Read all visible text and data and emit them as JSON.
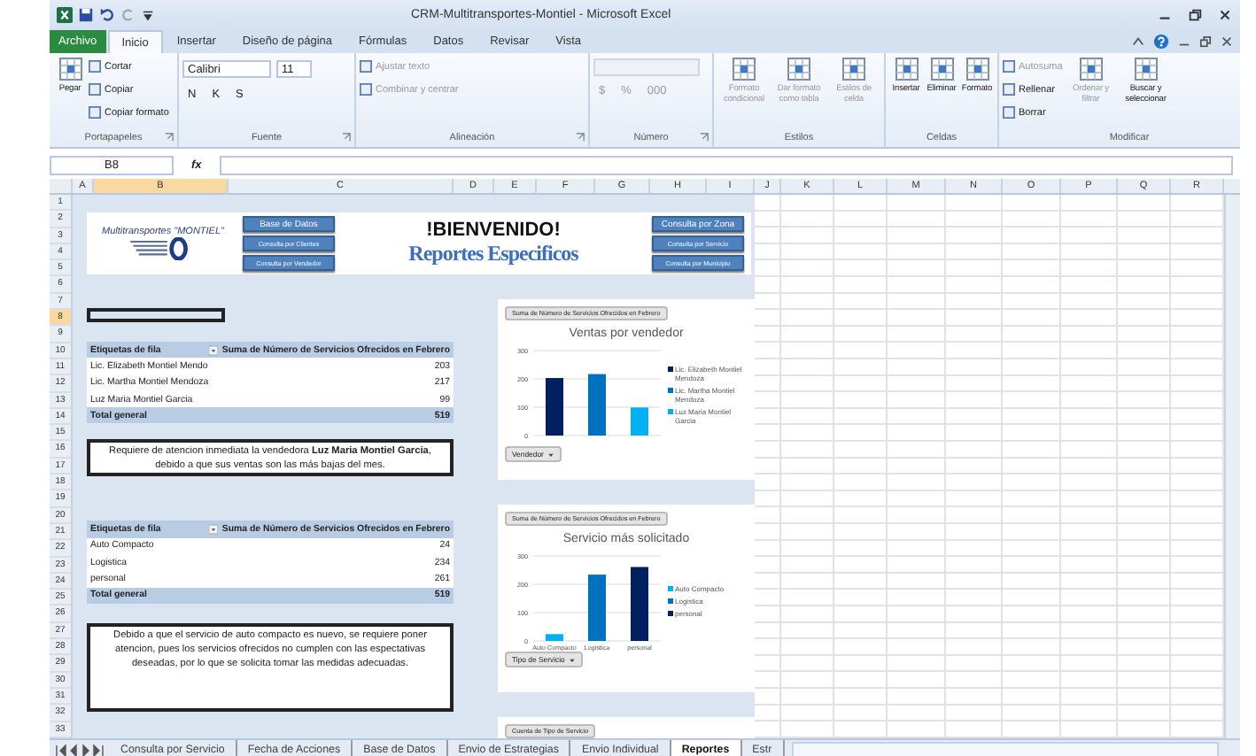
{
  "window": {
    "title": "CRM-Multitransportes-Montiel - Microsoft Excel"
  },
  "ribbon_tabs": [
    {
      "label": "Archivo",
      "kind": "file",
      "selected": false
    },
    {
      "label": "Inicio",
      "kind": "tab",
      "selected": true
    },
    {
      "label": "Insertar",
      "kind": "tab",
      "selected": false
    },
    {
      "label": "Diseño de página",
      "kind": "tab",
      "selected": false
    },
    {
      "label": "Fórmulas",
      "kind": "tab",
      "selected": false
    },
    {
      "label": "Datos",
      "kind": "tab",
      "selected": false
    },
    {
      "label": "Revisar",
      "kind": "tab",
      "selected": false
    },
    {
      "label": "Vista",
      "kind": "tab",
      "selected": false
    }
  ],
  "ribbon_groups": [
    {
      "label": "Portapapeles",
      "launcher": true,
      "columns": [
        {
          "items": [
            {
              "kind": "big",
              "label": "Pegar",
              "disabled": false
            }
          ]
        },
        {
          "items": [
            {
              "kind": "small",
              "label": "Cortar",
              "disabled": false
            },
            {
              "kind": "small",
              "label": "Copiar",
              "disabled": false
            },
            {
              "kind": "small",
              "label": "Copiar formato",
              "disabled": false
            }
          ]
        }
      ]
    },
    {
      "label": "Fuente",
      "launcher": true,
      "columns": [
        {
          "items": [
            {
              "kind": "fontbox",
              "font": "Calibri",
              "size": "11",
              "disabled": false
            },
            {
              "kind": "letters",
              "letters": [
                "N",
                "K",
                "S"
              ],
              "disabled": false
            }
          ]
        }
      ]
    },
    {
      "label": "Alineación",
      "launcher": true,
      "columns": [
        {
          "items": [
            {
              "kind": "small",
              "label": "Ajustar texto",
              "disabled": true
            },
            {
              "kind": "small",
              "label": "Combinar y centrar",
              "disabled": true
            }
          ]
        }
      ]
    },
    {
      "label": "Número",
      "launcher": true,
      "columns": [
        {
          "items": [
            {
              "kind": "combo",
              "disabled": true
            },
            {
              "kind": "letters",
              "letters": [
                "$",
                "%",
                "000"
              ],
              "disabled": true
            }
          ]
        }
      ]
    },
    {
      "label": "Estilos",
      "launcher": false,
      "columns": [
        {
          "items": [
            {
              "kind": "big",
              "label": "Formato condicional",
              "disabled": true
            }
          ]
        },
        {
          "items": [
            {
              "kind": "big",
              "label": "Dar formato como tabla",
              "disabled": true
            }
          ]
        },
        {
          "items": [
            {
              "kind": "big",
              "label": "Estilos de celda",
              "disabled": true
            }
          ]
        }
      ]
    },
    {
      "label": "Celdas",
      "launcher": false,
      "columns": [
        {
          "items": [
            {
              "kind": "big",
              "label": "Insertar",
              "disabled": false
            }
          ]
        },
        {
          "items": [
            {
              "kind": "big",
              "label": "Eliminar",
              "disabled": false
            }
          ]
        },
        {
          "items": [
            {
              "kind": "big",
              "label": "Formato",
              "disabled": false
            }
          ]
        }
      ]
    },
    {
      "label": "Modificar",
      "launcher": false,
      "columns": [
        {
          "items": [
            {
              "kind": "small",
              "label": "Autosuma",
              "disabled": true
            },
            {
              "kind": "small",
              "label": "Rellenar",
              "disabled": false
            },
            {
              "kind": "small",
              "label": "Borrar",
              "disabled": false
            }
          ]
        },
        {
          "items": [
            {
              "kind": "big",
              "label": "Ordenar y filtrar",
              "disabled": true
            }
          ]
        },
        {
          "items": [
            {
              "kind": "big",
              "label": "Buscar y seleccionar",
              "disabled": false
            }
          ]
        }
      ]
    }
  ],
  "formula_bar": {
    "name_box": "B8",
    "function_label": "fx"
  },
  "columns": [
    {
      "label": "A",
      "selected": false
    },
    {
      "label": "B",
      "selected": true
    },
    {
      "label": "C",
      "selected": false
    },
    {
      "label": "D",
      "selected": false
    },
    {
      "label": "E",
      "selected": false
    },
    {
      "label": "F",
      "selected": false
    },
    {
      "label": "G",
      "selected": false
    },
    {
      "label": "H",
      "selected": false
    },
    {
      "label": "I",
      "selected": false
    },
    {
      "label": "J",
      "selected": false
    },
    {
      "label": "K",
      "selected": false
    },
    {
      "label": "L",
      "selected": false
    },
    {
      "label": "M",
      "selected": false
    },
    {
      "label": "N",
      "selected": false
    },
    {
      "label": "O",
      "selected": false
    },
    {
      "label": "P",
      "selected": false
    },
    {
      "label": "Q",
      "selected": false
    },
    {
      "label": "R",
      "selected": false
    }
  ],
  "rows": [
    {
      "label": "1",
      "selected": false
    },
    {
      "label": "2",
      "selected": false
    },
    {
      "label": "3",
      "selected": false
    },
    {
      "label": "4",
      "selected": false
    },
    {
      "label": "5",
      "selected": false
    },
    {
      "label": "6",
      "selected": false
    },
    {
      "label": "7",
      "selected": false
    },
    {
      "label": "8",
      "selected": true
    },
    {
      "label": "9",
      "selected": false
    },
    {
      "label": "10",
      "selected": false
    },
    {
      "label": "11",
      "selected": false
    },
    {
      "label": "12",
      "selected": false
    },
    {
      "label": "13",
      "selected": false
    },
    {
      "label": "14",
      "selected": false
    },
    {
      "label": "15",
      "selected": false
    },
    {
      "label": "16",
      "selected": false
    },
    {
      "label": "17",
      "selected": false
    },
    {
      "label": "18",
      "selected": false
    },
    {
      "label": "19",
      "selected": false
    },
    {
      "label": "20",
      "selected": false
    },
    {
      "label": "21",
      "selected": false
    },
    {
      "label": "22",
      "selected": false
    },
    {
      "label": "23",
      "selected": false
    },
    {
      "label": "24",
      "selected": false
    },
    {
      "label": "25",
      "selected": false
    },
    {
      "label": "26",
      "selected": false
    },
    {
      "label": "27",
      "selected": false
    },
    {
      "label": "28",
      "selected": false
    },
    {
      "label": "29",
      "selected": false
    },
    {
      "label": "30",
      "selected": false
    },
    {
      "label": "31",
      "selected": false
    },
    {
      "label": "32",
      "selected": false
    },
    {
      "label": "33",
      "selected": false
    }
  ],
  "dashboard": {
    "logo_text": "Multitransportes \"MONTIEL\"",
    "left_buttons": [
      "Base de Datos",
      "Consulta por Clientes",
      "Consulta por Vendedor"
    ],
    "welcome": "!BIENVENIDO!",
    "subtitle": "Reportes Especificos",
    "right_buttons": [
      "Consulta por Zona",
      "Consulta por Servicio",
      "Consulta por Municipio"
    ]
  },
  "pivots": [
    {
      "columns": [
        "Etiquetas de fila",
        "Suma de Número de Servicios Ofrecidos en Febrero"
      ],
      "rows": [
        {
          "label": "Lic. Elizabeth Montiel Mendo",
          "value": "203"
        },
        {
          "label": "Lic. Martha Montiel Mendoza",
          "value": "217"
        },
        {
          "label": "Luz Maria Montiel Garcia",
          "value": "99"
        }
      ],
      "total": {
        "label": "Total general",
        "value": "519"
      },
      "note": "Requiere de atencion inmediata la vendedora **Luz Maria Montiel Garcia**, debido a que sus ventas son las más bajas del mes."
    },
    {
      "columns": [
        "Etiquetas de fila",
        "Suma de Número de Servicios Ofrecidos en Febrero"
      ],
      "rows": [
        {
          "label": "Auto Compacto",
          "value": "24"
        },
        {
          "label": "Logistica",
          "value": "234"
        },
        {
          "label": "personal",
          "value": "261"
        }
      ],
      "total": {
        "label": "Total general",
        "value": "519"
      },
      "note": "Debido a que el servicio de auto compacto es nuevo, se requiere poner atencion, pues los servicios ofrecidos no cumplen con las espectativas deseadas, por lo que se solicita tomar las medidas adecuadas."
    }
  ],
  "charts": [
    {
      "value_field": "Suma de Número de Servicios Ofrecidos en Febrero",
      "axis_field": "Vendedor",
      "chart_data": {
        "type": "bar",
        "title": "Ventas por vendedor",
        "ylim": [
          0,
          300
        ],
        "yticks": [
          0,
          100,
          200,
          300
        ],
        "series": [
          {
            "name": "Lic. Elizabeth Montiel Mendoza",
            "color": "#002060",
            "values": [
              203
            ]
          },
          {
            "name": "Lic. Martha Montiel Mendoza",
            "color": "#0070c0",
            "values": [
              217
            ]
          },
          {
            "name": "Luz Maria Montiel Garcia",
            "color": "#00b0f0",
            "values": [
              99
            ]
          }
        ]
      }
    },
    {
      "value_field": "Suma de Número de Servicios Ofrecidos en Febrero",
      "axis_field": "Tipo de Servicio",
      "chart_data": {
        "type": "bar",
        "title": "Servicio más solicitado",
        "categories": [
          "Auto Compacto",
          "Logistica",
          "personal"
        ],
        "ylim": [
          0,
          300
        ],
        "yticks": [
          0,
          100,
          200,
          300
        ],
        "series": [
          {
            "name": "Auto Compacto",
            "color": "#00b0f0",
            "values": [
              24,
              null,
              null
            ]
          },
          {
            "name": "Logistica",
            "color": "#0070c0",
            "values": [
              null,
              234,
              null
            ]
          },
          {
            "name": "personal",
            "color": "#002060",
            "values": [
              null,
              null,
              261
            ]
          }
        ]
      }
    },
    {
      "value_field": "Cuenta de Tipo de Servicio"
    }
  ],
  "sheet_tabs": [
    {
      "label": "Consulta por Servicio",
      "selected": false
    },
    {
      "label": "Fecha de Acciones",
      "selected": false
    },
    {
      "label": "Base de Datos",
      "selected": false
    },
    {
      "label": "Envio de Estrategias",
      "selected": false
    },
    {
      "label": "Envio Individual",
      "selected": false
    },
    {
      "label": "Reportes",
      "selected": true
    },
    {
      "label": "Estr",
      "selected": false
    }
  ]
}
